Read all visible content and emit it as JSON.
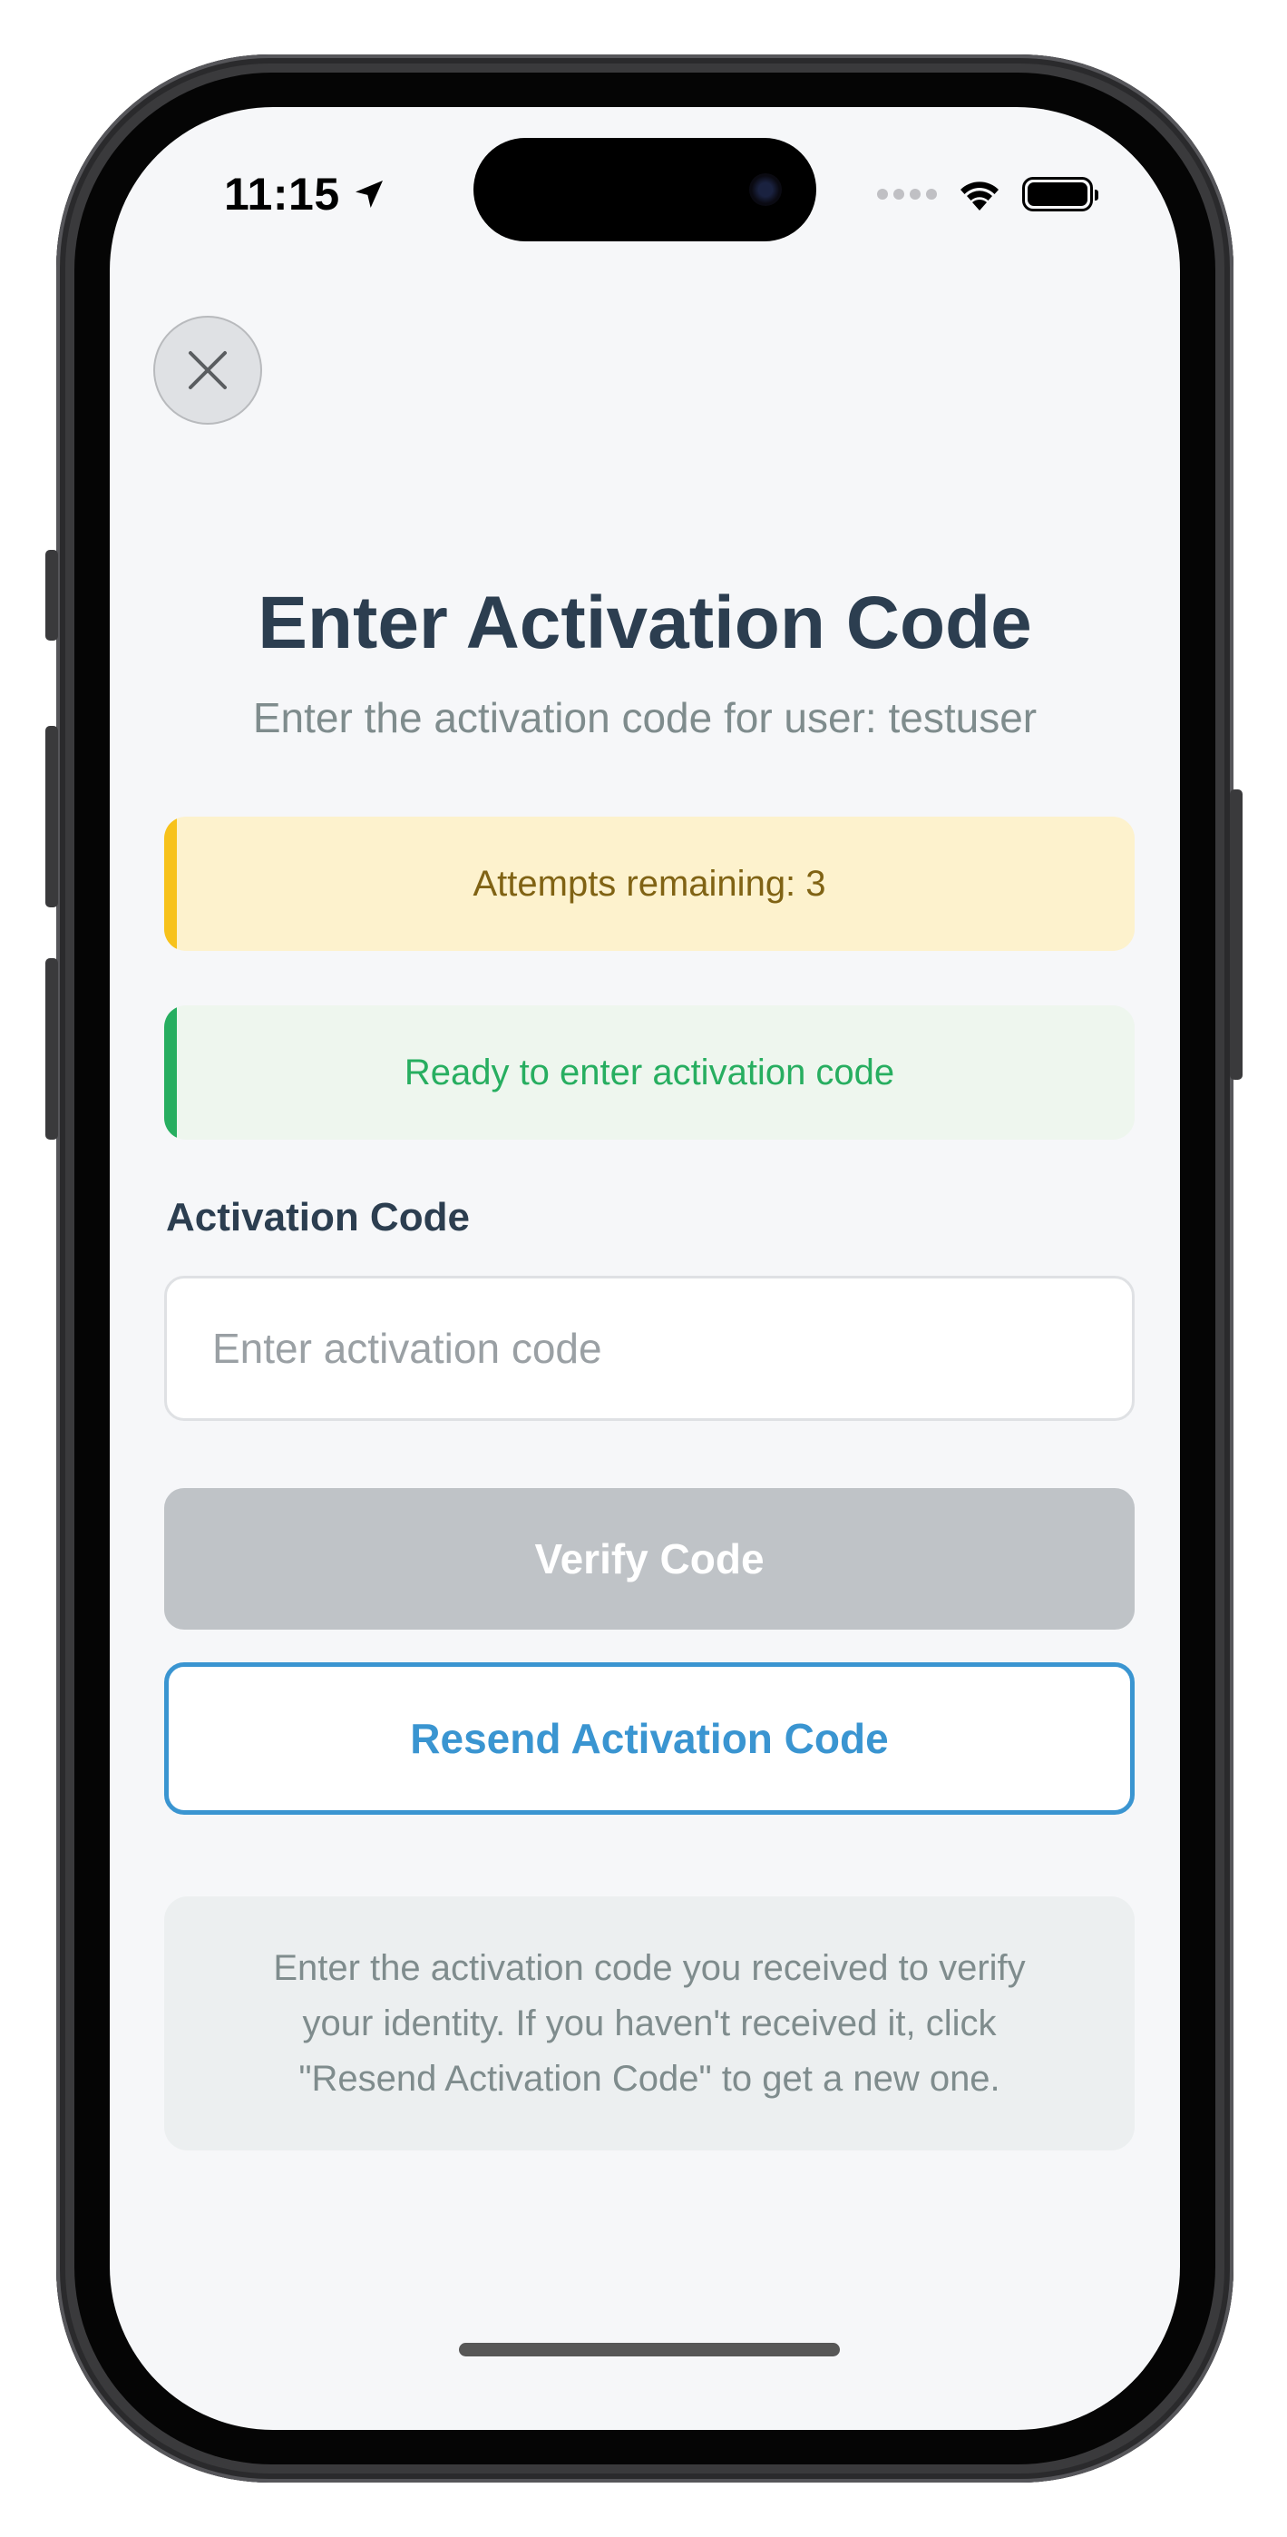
{
  "status_bar": {
    "time": "11:15",
    "location_icon": "location-arrow-icon",
    "wifi_icon": "wifi-icon",
    "battery_icon": "battery-icon",
    "battery_level": 1.0
  },
  "close_button": {
    "icon": "close-icon"
  },
  "header": {
    "title": "Enter Activation Code",
    "subtitle": "Enter the activation code for user: testuser"
  },
  "attempts_banner": {
    "text": "Attempts remaining: 3",
    "accent_color": "#f7c21b"
  },
  "status_banner": {
    "text": "Ready to enter activation code",
    "accent_color": "#27ae60"
  },
  "activation_field": {
    "label": "Activation Code",
    "value": "",
    "placeholder": "Enter activation code"
  },
  "buttons": {
    "verify_label": "Verify Code",
    "resend_label": "Resend Activation Code"
  },
  "help": {
    "text": "Enter the activation code you received to verify your identity. If you haven't received it, click \"Resend Activation Code\" to get a new one."
  },
  "colors": {
    "title": "#2c3e50",
    "muted": "#7f8c8d",
    "accent": "#3a95d1",
    "disabled": "#bfc3c7"
  }
}
